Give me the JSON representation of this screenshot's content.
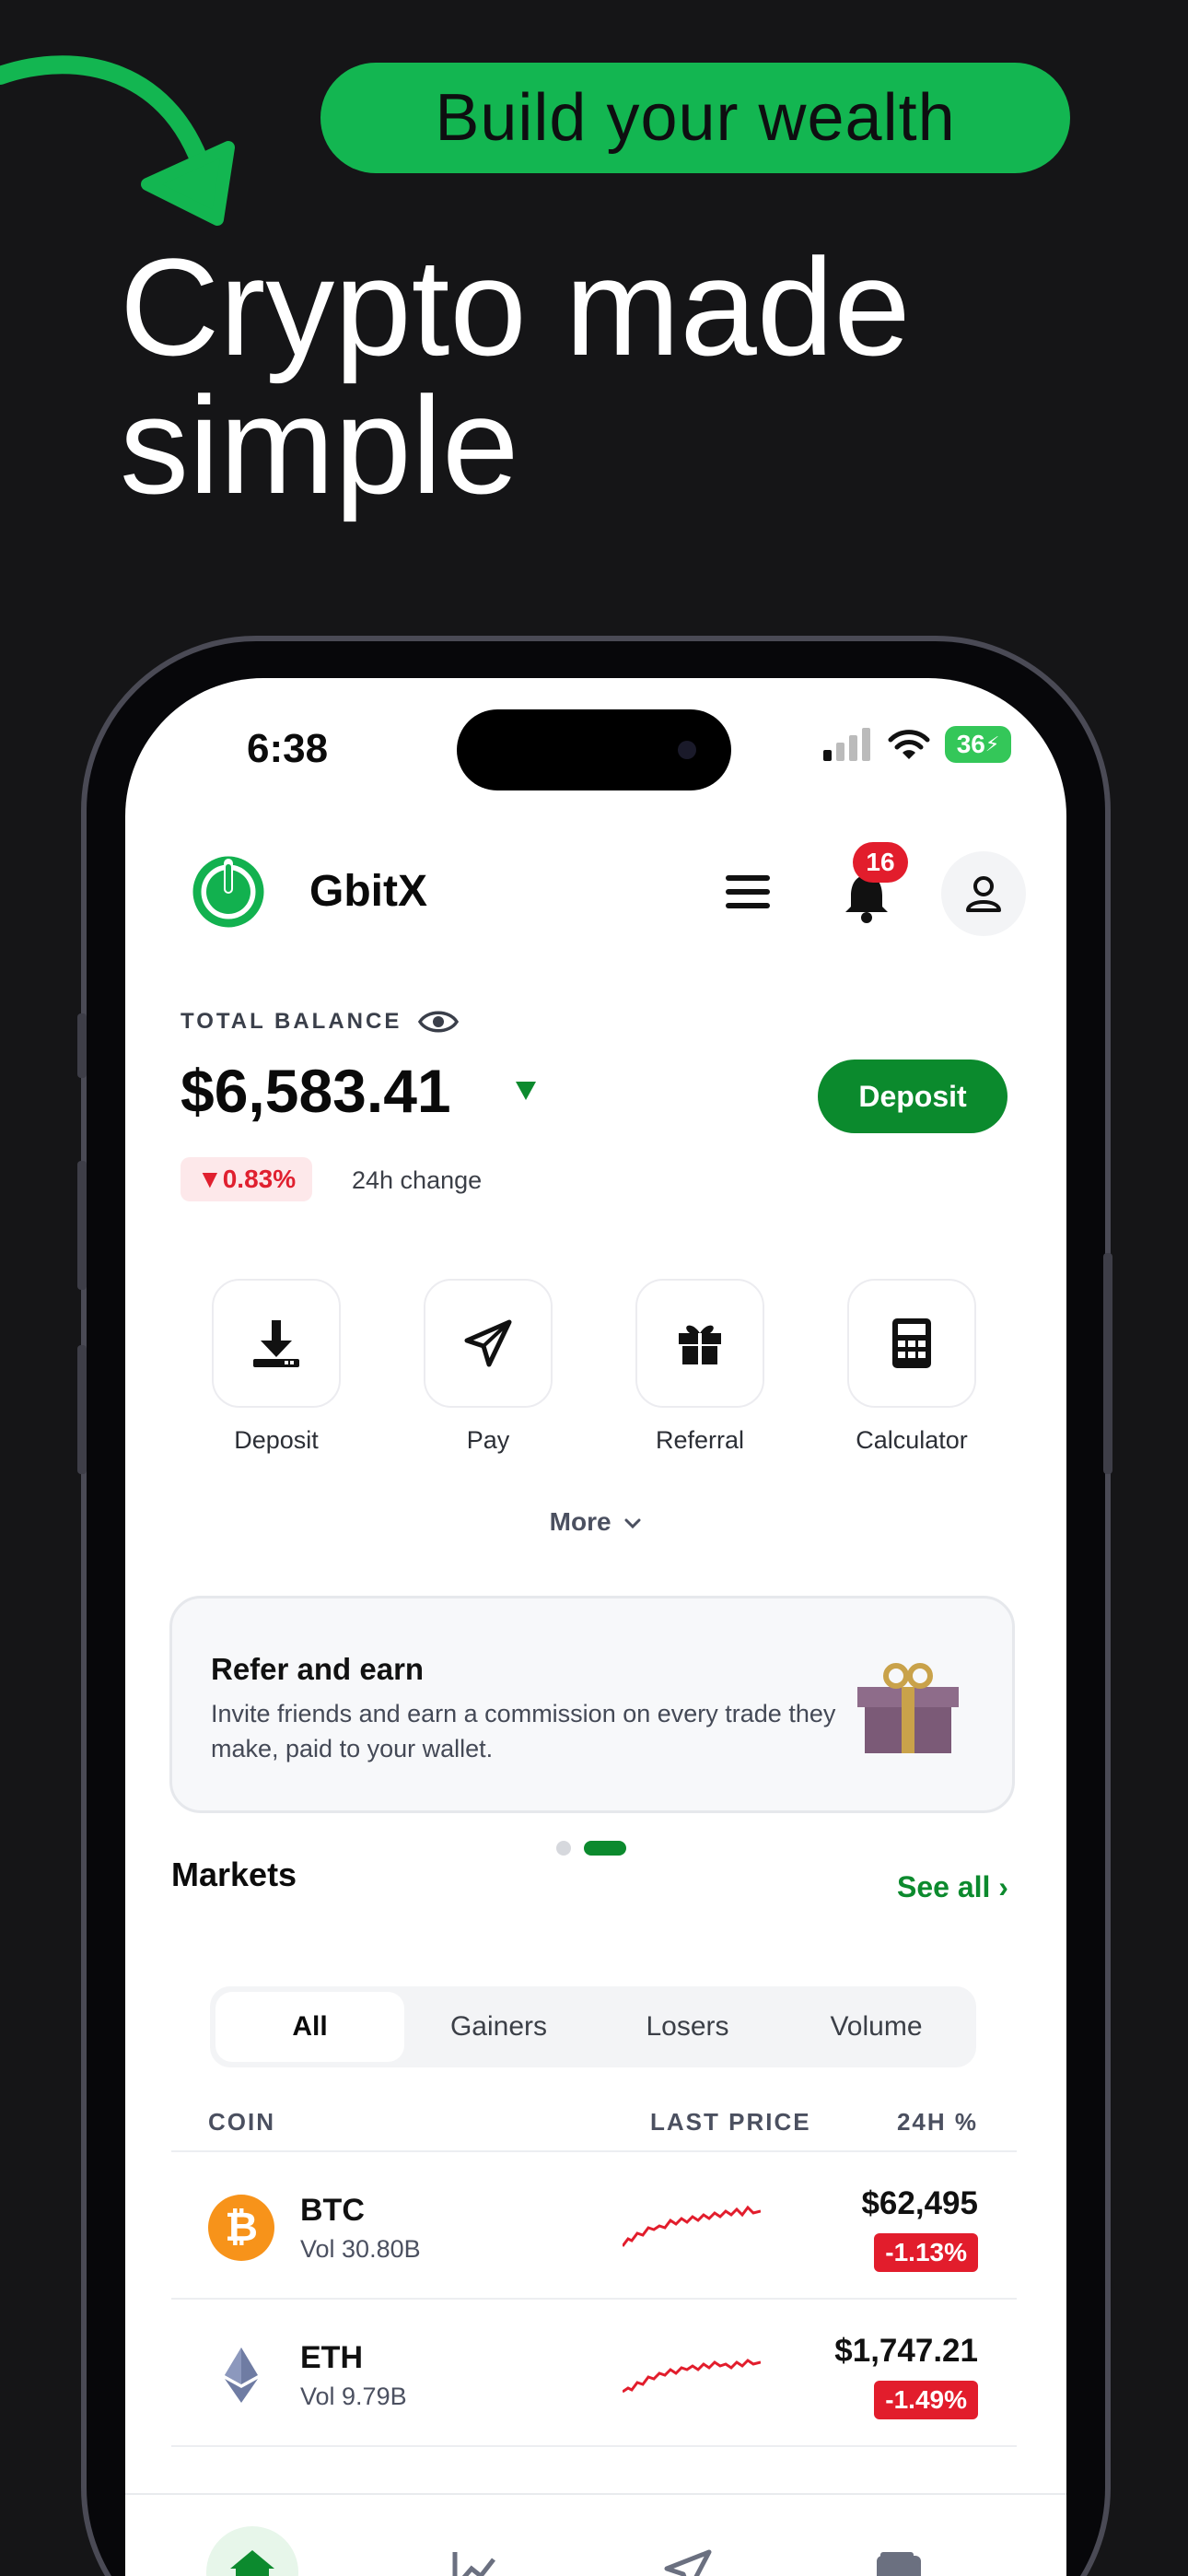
{
  "promo": {
    "tag": "Build your wealth",
    "headline_line1": "Crypto made",
    "headline_line2": "simple"
  },
  "status_bar": {
    "time": "6:38",
    "battery": "36"
  },
  "app": {
    "brand": "GbitX",
    "notification_count": "16",
    "balance_label": "TOTAL BALANCE",
    "balance_value": "$6,583.41",
    "deposit_button": "Deposit",
    "change_value": "▼0.83%",
    "change_label": "24h change"
  },
  "quick_actions": [
    {
      "label": "Deposit",
      "icon": "download-tray-icon"
    },
    {
      "label": "Pay",
      "icon": "paper-plane-icon"
    },
    {
      "label": "Referral",
      "icon": "gift-icon"
    },
    {
      "label": "Calculator",
      "icon": "calculator-icon"
    }
  ],
  "more_label": "More",
  "refer_card": {
    "title": "Refer and earn",
    "text": "Invite friends and earn a commission on every trade they make, paid to your wallet."
  },
  "markets": {
    "title": "Markets",
    "see_all": "See all ›",
    "tabs": [
      "All",
      "Gainers",
      "Losers",
      "Volume"
    ],
    "active_tab": "All",
    "columns": {
      "coin": "COIN",
      "last_price": "LAST PRICE",
      "change": "24H %"
    },
    "rows": [
      {
        "symbol": "BTC",
        "volume": "Vol 30.80B",
        "price": "$62,495",
        "change": "-1.13%"
      },
      {
        "symbol": "ETH",
        "volume": "Vol 9.79B",
        "price": "$1,747.21",
        "change": "-1.49%"
      }
    ]
  },
  "colors": {
    "brand_green": "#0b8a2d",
    "promo_green": "#13b651",
    "negative_red": "#e21d2c",
    "background": "#151517"
  }
}
